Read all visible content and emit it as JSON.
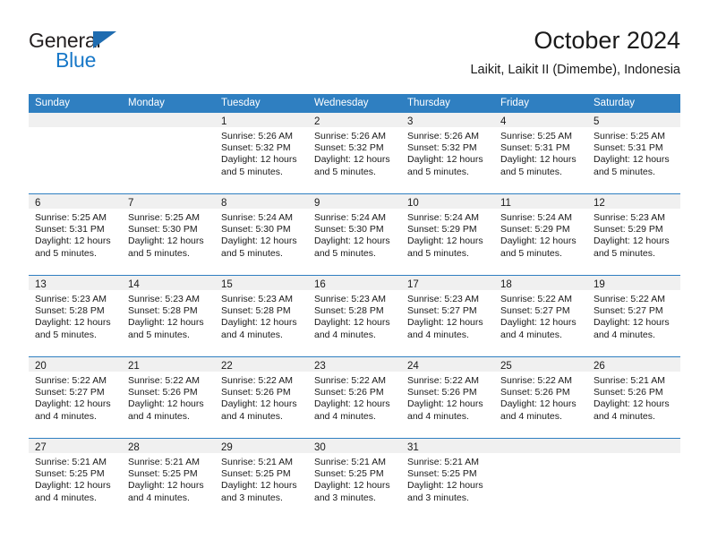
{
  "brand": {
    "name_top": "General",
    "name_bottom": "Blue",
    "accent_color": "#1878c8",
    "triangle_color": "#1f6cb0"
  },
  "header": {
    "title": "October 2024",
    "subtitle": "Laikit, Laikit II (Dimembe), Indonesia",
    "header_bar_color": "#2f7fc1",
    "day_band_color": "#f0f0f0"
  },
  "weekdays": [
    "Sunday",
    "Monday",
    "Tuesday",
    "Wednesday",
    "Thursday",
    "Friday",
    "Saturday"
  ],
  "labels": {
    "sunrise_prefix": "Sunrise:",
    "sunset_prefix": "Sunset:",
    "daylight_prefix": "Daylight:"
  },
  "weeks": [
    [
      {
        "day": "",
        "sunrise": "",
        "sunset": "",
        "daylight": "",
        "empty": true
      },
      {
        "day": "",
        "sunrise": "",
        "sunset": "",
        "daylight": "",
        "empty": true
      },
      {
        "day": "1",
        "sunrise": "Sunrise: 5:26 AM",
        "sunset": "Sunset: 5:32 PM",
        "daylight": "Daylight: 12 hours and 5 minutes."
      },
      {
        "day": "2",
        "sunrise": "Sunrise: 5:26 AM",
        "sunset": "Sunset: 5:32 PM",
        "daylight": "Daylight: 12 hours and 5 minutes."
      },
      {
        "day": "3",
        "sunrise": "Sunrise: 5:26 AM",
        "sunset": "Sunset: 5:32 PM",
        "daylight": "Daylight: 12 hours and 5 minutes."
      },
      {
        "day": "4",
        "sunrise": "Sunrise: 5:25 AM",
        "sunset": "Sunset: 5:31 PM",
        "daylight": "Daylight: 12 hours and 5 minutes."
      },
      {
        "day": "5",
        "sunrise": "Sunrise: 5:25 AM",
        "sunset": "Sunset: 5:31 PM",
        "daylight": "Daylight: 12 hours and 5 minutes."
      }
    ],
    [
      {
        "day": "6",
        "sunrise": "Sunrise: 5:25 AM",
        "sunset": "Sunset: 5:31 PM",
        "daylight": "Daylight: 12 hours and 5 minutes."
      },
      {
        "day": "7",
        "sunrise": "Sunrise: 5:25 AM",
        "sunset": "Sunset: 5:30 PM",
        "daylight": "Daylight: 12 hours and 5 minutes."
      },
      {
        "day": "8",
        "sunrise": "Sunrise: 5:24 AM",
        "sunset": "Sunset: 5:30 PM",
        "daylight": "Daylight: 12 hours and 5 minutes."
      },
      {
        "day": "9",
        "sunrise": "Sunrise: 5:24 AM",
        "sunset": "Sunset: 5:30 PM",
        "daylight": "Daylight: 12 hours and 5 minutes."
      },
      {
        "day": "10",
        "sunrise": "Sunrise: 5:24 AM",
        "sunset": "Sunset: 5:29 PM",
        "daylight": "Daylight: 12 hours and 5 minutes."
      },
      {
        "day": "11",
        "sunrise": "Sunrise: 5:24 AM",
        "sunset": "Sunset: 5:29 PM",
        "daylight": "Daylight: 12 hours and 5 minutes."
      },
      {
        "day": "12",
        "sunrise": "Sunrise: 5:23 AM",
        "sunset": "Sunset: 5:29 PM",
        "daylight": "Daylight: 12 hours and 5 minutes."
      }
    ],
    [
      {
        "day": "13",
        "sunrise": "Sunrise: 5:23 AM",
        "sunset": "Sunset: 5:28 PM",
        "daylight": "Daylight: 12 hours and 5 minutes."
      },
      {
        "day": "14",
        "sunrise": "Sunrise: 5:23 AM",
        "sunset": "Sunset: 5:28 PM",
        "daylight": "Daylight: 12 hours and 5 minutes."
      },
      {
        "day": "15",
        "sunrise": "Sunrise: 5:23 AM",
        "sunset": "Sunset: 5:28 PM",
        "daylight": "Daylight: 12 hours and 4 minutes."
      },
      {
        "day": "16",
        "sunrise": "Sunrise: 5:23 AM",
        "sunset": "Sunset: 5:28 PM",
        "daylight": "Daylight: 12 hours and 4 minutes."
      },
      {
        "day": "17",
        "sunrise": "Sunrise: 5:23 AM",
        "sunset": "Sunset: 5:27 PM",
        "daylight": "Daylight: 12 hours and 4 minutes."
      },
      {
        "day": "18",
        "sunrise": "Sunrise: 5:22 AM",
        "sunset": "Sunset: 5:27 PM",
        "daylight": "Daylight: 12 hours and 4 minutes."
      },
      {
        "day": "19",
        "sunrise": "Sunrise: 5:22 AM",
        "sunset": "Sunset: 5:27 PM",
        "daylight": "Daylight: 12 hours and 4 minutes."
      }
    ],
    [
      {
        "day": "20",
        "sunrise": "Sunrise: 5:22 AM",
        "sunset": "Sunset: 5:27 PM",
        "daylight": "Daylight: 12 hours and 4 minutes."
      },
      {
        "day": "21",
        "sunrise": "Sunrise: 5:22 AM",
        "sunset": "Sunset: 5:26 PM",
        "daylight": "Daylight: 12 hours and 4 minutes."
      },
      {
        "day": "22",
        "sunrise": "Sunrise: 5:22 AM",
        "sunset": "Sunset: 5:26 PM",
        "daylight": "Daylight: 12 hours and 4 minutes."
      },
      {
        "day": "23",
        "sunrise": "Sunrise: 5:22 AM",
        "sunset": "Sunset: 5:26 PM",
        "daylight": "Daylight: 12 hours and 4 minutes."
      },
      {
        "day": "24",
        "sunrise": "Sunrise: 5:22 AM",
        "sunset": "Sunset: 5:26 PM",
        "daylight": "Daylight: 12 hours and 4 minutes."
      },
      {
        "day": "25",
        "sunrise": "Sunrise: 5:22 AM",
        "sunset": "Sunset: 5:26 PM",
        "daylight": "Daylight: 12 hours and 4 minutes."
      },
      {
        "day": "26",
        "sunrise": "Sunrise: 5:21 AM",
        "sunset": "Sunset: 5:26 PM",
        "daylight": "Daylight: 12 hours and 4 minutes."
      }
    ],
    [
      {
        "day": "27",
        "sunrise": "Sunrise: 5:21 AM",
        "sunset": "Sunset: 5:25 PM",
        "daylight": "Daylight: 12 hours and 4 minutes."
      },
      {
        "day": "28",
        "sunrise": "Sunrise: 5:21 AM",
        "sunset": "Sunset: 5:25 PM",
        "daylight": "Daylight: 12 hours and 4 minutes."
      },
      {
        "day": "29",
        "sunrise": "Sunrise: 5:21 AM",
        "sunset": "Sunset: 5:25 PM",
        "daylight": "Daylight: 12 hours and 3 minutes."
      },
      {
        "day": "30",
        "sunrise": "Sunrise: 5:21 AM",
        "sunset": "Sunset: 5:25 PM",
        "daylight": "Daylight: 12 hours and 3 minutes."
      },
      {
        "day": "31",
        "sunrise": "Sunrise: 5:21 AM",
        "sunset": "Sunset: 5:25 PM",
        "daylight": "Daylight: 12 hours and 3 minutes."
      },
      {
        "day": "",
        "sunrise": "",
        "sunset": "",
        "daylight": "",
        "empty": true
      },
      {
        "day": "",
        "sunrise": "",
        "sunset": "",
        "daylight": "",
        "empty": true
      }
    ]
  ]
}
